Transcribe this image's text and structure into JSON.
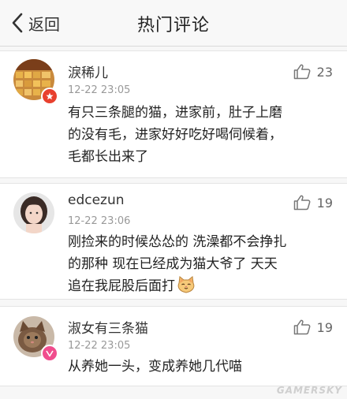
{
  "nav": {
    "back_label": "返回",
    "title": "热门评论"
  },
  "comments": [
    {
      "user": "淚稀儿",
      "time": "12-22 23:05",
      "likes": "23",
      "lines": [
        "有只三条腿的猫，进家前，肚子上磨",
        "的没有毛，进家好好吃好喝伺候着，",
        "毛都长出来了"
      ]
    },
    {
      "user": "edcezun",
      "time": "12-22 23:06",
      "likes": "19",
      "lines": [
        "刚捡来的时候怂怂的 洗澡都不会挣扎",
        "的那种 现在已经成为猫大爷了 天天",
        "追在我屁股后面打"
      ]
    },
    {
      "user": "淑女有三条猫",
      "time": "12-22 23:05",
      "likes": "19",
      "lines": [
        "从养她一头，变成养她几代喵"
      ]
    }
  ],
  "watermark": "GAMERSKY",
  "colors": {
    "badge_red": "#e8402e",
    "badge_pink": "#f04d8d"
  },
  "icons": [
    "back-chevron-icon",
    "thumbs-up-icon",
    "cat-face-emoji"
  ]
}
